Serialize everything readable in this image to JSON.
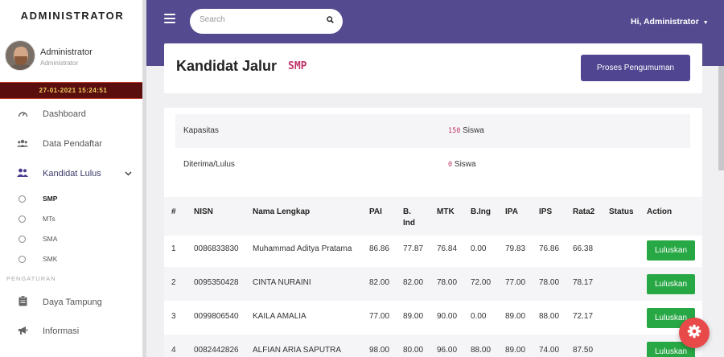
{
  "sidebar": {
    "brand": "ADMINISTRATOR",
    "user_name": "Administrator",
    "user_role": "Administrator",
    "clock": "27-01-2021 15:24:51",
    "items": [
      {
        "label": "Dashboard",
        "icon": "dashboard-gauge-icon"
      },
      {
        "label": "Data Pendaftar",
        "icon": "users-icon"
      },
      {
        "label": "Kandidat Lulus",
        "icon": "user-group-icon"
      }
    ],
    "subitems": [
      "SMP",
      "MTs",
      "SMA",
      "SMK"
    ],
    "section_label": "PENGATURAN",
    "settings_items": [
      {
        "label": "Daya Tampung",
        "icon": "clipboard-icon"
      },
      {
        "label": "Informasi",
        "icon": "megaphone-icon"
      }
    ]
  },
  "header": {
    "search_placeholder": "Search",
    "user_menu": "Hi, Administrator"
  },
  "page": {
    "title": "Kandidat Jalur",
    "subtitle": "SMP",
    "proses_label": "Proses Pengumuman"
  },
  "info": {
    "kapasitas_label": "Kapasitas",
    "kapasitas_value": "150",
    "kapasitas_unit": "Siswa",
    "diterima_label": "Diterima/Lulus",
    "diterima_value": "0",
    "diterima_unit": "Siswa"
  },
  "table": {
    "headers": [
      "#",
      "NISN",
      "Nama Lengkap",
      "PAI",
      "B. Ind",
      "MTK",
      "B.Ing",
      "IPA",
      "IPS",
      "Rata2",
      "Status",
      "Action"
    ],
    "action_label": "Luluskan",
    "rows": [
      [
        "1",
        "0086833830",
        "Muhammad Aditya Pratama",
        "86.86",
        "77.87",
        "76.84",
        "0.00",
        "79.83",
        "76.86",
        "66.38",
        ""
      ],
      [
        "2",
        "0095350428",
        "CINTA NURAINI",
        "82.00",
        "82.00",
        "78.00",
        "72.00",
        "77.00",
        "78.00",
        "78.17",
        ""
      ],
      [
        "3",
        "0099806540",
        "KAILA AMALIA",
        "77.00",
        "89.00",
        "90.00",
        "0.00",
        "89.00",
        "88.00",
        "72.17",
        ""
      ],
      [
        "4",
        "0082442826",
        "ALFIAN ARIA SAPUTRA",
        "98.00",
        "80.00",
        "96.00",
        "88.00",
        "89.00",
        "74.00",
        "87.50",
        ""
      ]
    ]
  },
  "colors": {
    "accent": "#544a8f",
    "success": "#28a745",
    "highlight": "#c2356c",
    "clock_bg": "#5b0e0e"
  }
}
